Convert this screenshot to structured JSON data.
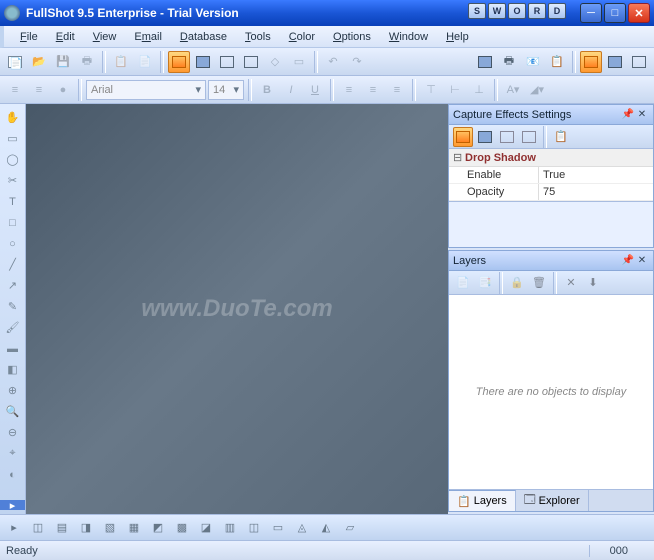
{
  "titlebar": {
    "text": "FullShot 9.5 Enterprise - Trial Version",
    "quick_buttons": [
      "S",
      "W",
      "O",
      "R",
      "D"
    ]
  },
  "menu": [
    "File",
    "Edit",
    "View",
    "Email",
    "Database",
    "Tools",
    "Color",
    "Options",
    "Window",
    "Help"
  ],
  "format": {
    "font": "Arial",
    "size": "14"
  },
  "watermark": "www.DuoTe.com",
  "capture_panel": {
    "title": "Capture Effects Settings",
    "category": "Drop Shadow",
    "props": [
      {
        "name": "Enable",
        "value": "True"
      },
      {
        "name": "Opacity",
        "value": "75"
      }
    ]
  },
  "layers_panel": {
    "title": "Layers",
    "empty_msg": "There are no objects to display",
    "tabs": [
      "Layers",
      "Explorer"
    ]
  },
  "status": {
    "text": "Ready",
    "coord": "000"
  }
}
